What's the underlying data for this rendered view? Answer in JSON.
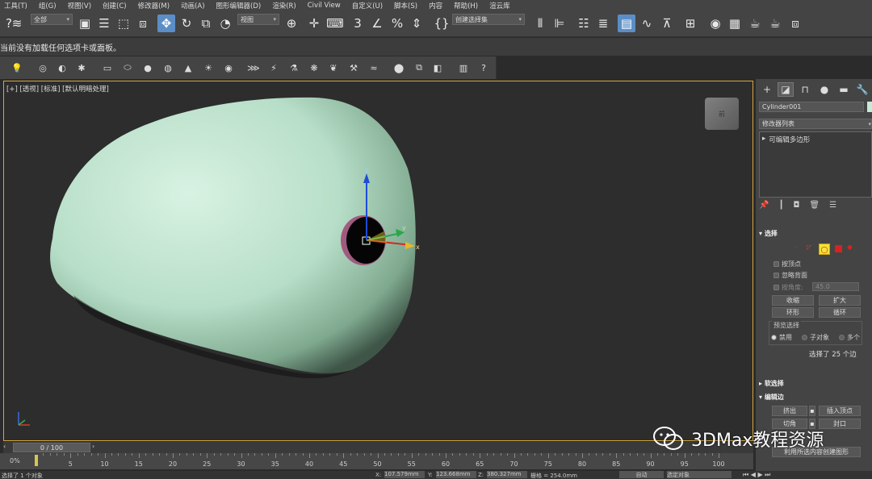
{
  "menu": [
    "工具(T)",
    "组(G)",
    "视图(V)",
    "创建(C)",
    "修改器(M)",
    "动画(A)",
    "图形编辑器(D)",
    "渲染(R)",
    "Civil View",
    "自定义(U)",
    "脚本(S)",
    "内容",
    "帮助(H)",
    "渲云库"
  ],
  "toolbar": {
    "filter_dropdown": "全部",
    "ref_coord_dropdown": "视图",
    "named_selection_dropdown": "创建选择集",
    "help_glyph": "?"
  },
  "prompt_text": "当前没有加载任何选项卡或面板。",
  "viewport": {
    "label": "[+] [透视] [标准] [默认明暗处理]",
    "gizmo_x": "x",
    "gizmo_y": "y",
    "gizmo_z": "z",
    "viewcube_text": "前",
    "object_color": "#c7ead6",
    "border_color": "#d6a73a"
  },
  "command_panel": {
    "object_name": "Cylinder001",
    "modifier_list": "修改器列表",
    "stack_item": "可编辑多边形",
    "selection_rollout": "选择",
    "by_vertex": "按顶点",
    "ignore_backfacing": "忽略背面",
    "angle_label": "按角度:",
    "angle_value": "45.0",
    "shrink_button": "收缩",
    "grow_button": "扩大",
    "ring_button": "环形",
    "loop_button": "循环",
    "preview_selection": "预览选择",
    "preview_off": "禁用",
    "preview_subobject": "子对象",
    "preview_multi": "多个",
    "selected_info": "选择了 25 个边",
    "soft_selection": "软选择",
    "edit_edges": "编辑边",
    "extrude_button": "挤出",
    "insert_vertex_button": "插入顶点",
    "chamfer_button": "切角",
    "bridge_button": "封口",
    "create_shape_button": "利用所选内容创建图形"
  },
  "timeline": {
    "frame_counter": "0 / 100",
    "ticks": [
      "5",
      "10",
      "15",
      "20",
      "25",
      "30",
      "35",
      "40",
      "45",
      "50",
      "55",
      "60",
      "65",
      "70",
      "75",
      "80",
      "85",
      "90",
      "95",
      "100"
    ],
    "percent": "0%"
  },
  "statusbar": {
    "left": "选择了 1 个对象",
    "x_label": "X:",
    "x_value": "107.579mm",
    "y_label": "Y:",
    "y_value": "123.668mm",
    "z_label": "Z:",
    "z_value": "380.327mm",
    "grid": "栅格 = 254.0mm",
    "auto_key": "自动",
    "set_key": "选定对象"
  },
  "watermark": "3DMax教程资源"
}
